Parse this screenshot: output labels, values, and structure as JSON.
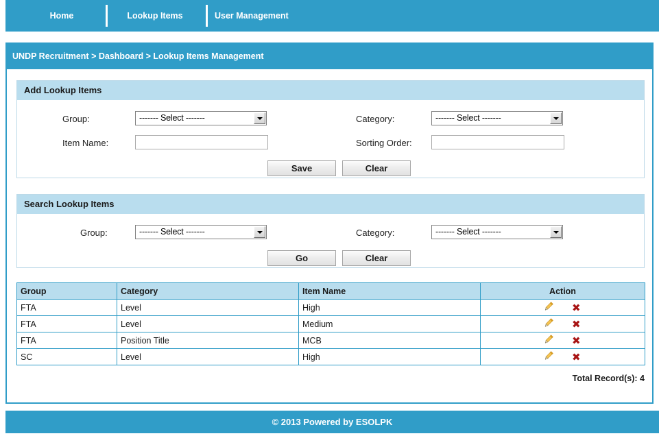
{
  "theme": {
    "brand_blue": "#309dc8",
    "panel_header_blue": "#b9ddee",
    "grid_border_blue": "#2f9cc7",
    "edit_icon_color": "#e8a317",
    "delete_icon_color": "#a81414"
  },
  "nav": {
    "items": [
      {
        "label": "Home"
      },
      {
        "label": "Lookup Items"
      },
      {
        "label": "User Management"
      }
    ]
  },
  "breadcrumb": {
    "text": "UNDP Recruitment > Dashboard > Lookup Items Management"
  },
  "add_panel": {
    "title": "Add Lookup Items",
    "group_label": "Group:",
    "group_value": "------- Select -------",
    "category_label": "Category:",
    "category_value": "------- Select -------",
    "item_name_label": "Item Name:",
    "item_name_value": "",
    "item_name_placeholder": "",
    "sorting_order_label": "Sorting Order:",
    "sorting_order_value": "",
    "sorting_order_placeholder": "",
    "save_label": "Save",
    "clear_label": "Clear"
  },
  "search_panel": {
    "title": "Search Lookup Items",
    "group_label": "Group:",
    "group_value": "------- Select -------",
    "category_label": "Category:",
    "category_value": "------- Select -------",
    "go_label": "Go",
    "clear_label": "Clear"
  },
  "grid": {
    "columns": [
      "Group",
      "Category",
      "Item Name",
      "Action"
    ],
    "rows": [
      {
        "group": "FTA",
        "category": "Level",
        "item_name": "High"
      },
      {
        "group": "FTA",
        "category": "Level",
        "item_name": "Medium"
      },
      {
        "group": "FTA",
        "category": "Position Title",
        "item_name": "MCB"
      },
      {
        "group": "SC",
        "category": "Level",
        "item_name": "High"
      }
    ],
    "edit_icon": "pencil-icon",
    "delete_icon": "cross-icon",
    "delete_glyph": "✖",
    "total_records": "Total Record(s): 4"
  },
  "footer": {
    "text": "© 2013 Powered by ESOLPK"
  }
}
